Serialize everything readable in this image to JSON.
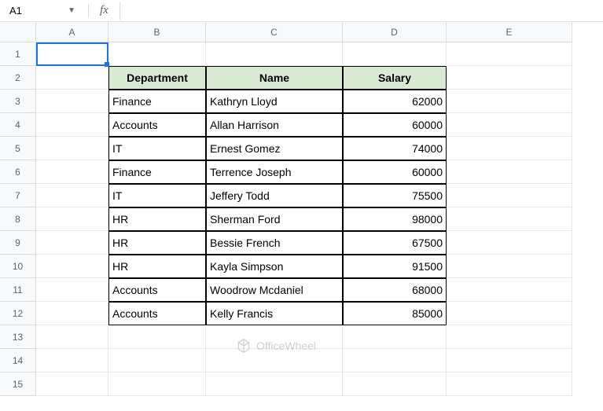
{
  "toolbar": {
    "cell_ref": "A1",
    "fx_label": "fx",
    "formula_value": ""
  },
  "columns": [
    "A",
    "B",
    "C",
    "D",
    "E"
  ],
  "rows": [
    "1",
    "2",
    "3",
    "4",
    "5",
    "6",
    "7",
    "8",
    "9",
    "10",
    "11",
    "12",
    "13",
    "14",
    "15"
  ],
  "table": {
    "headers": {
      "dept": "Department",
      "name": "Name",
      "salary": "Salary"
    },
    "data": [
      {
        "dept": "Finance",
        "name": "Kathryn Lloyd",
        "salary": "62000"
      },
      {
        "dept": "Accounts",
        "name": "Allan Harrison",
        "salary": "60000"
      },
      {
        "dept": "IT",
        "name": "Ernest Gomez",
        "salary": "74000"
      },
      {
        "dept": "Finance",
        "name": "Terrence Joseph",
        "salary": "60000"
      },
      {
        "dept": "IT",
        "name": "Jeffery Todd",
        "salary": "75500"
      },
      {
        "dept": "HR",
        "name": "Sherman Ford",
        "salary": "98000"
      },
      {
        "dept": "HR",
        "name": "Bessie French",
        "salary": "67500"
      },
      {
        "dept": "HR",
        "name": "Kayla Simpson",
        "salary": "91500"
      },
      {
        "dept": "Accounts",
        "name": "Woodrow Mcdaniel",
        "salary": "68000"
      },
      {
        "dept": "Accounts",
        "name": "Kelly Francis",
        "salary": "85000"
      }
    ]
  },
  "watermark": {
    "text": "OfficeWheel"
  }
}
